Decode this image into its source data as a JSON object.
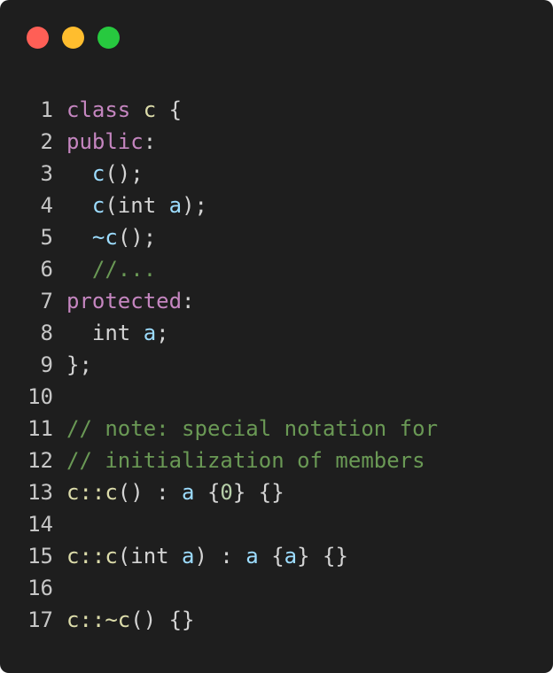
{
  "window": {
    "controls": {
      "close_color": "#ff5f56",
      "minimize_color": "#ffbd2e",
      "maximize_color": "#27c93f"
    }
  },
  "colors": {
    "keyword": "#c586c0",
    "type": "#dcdcaa",
    "identifier": "#9cdcfe",
    "comment": "#6a9955",
    "plain": "#d4d4d4",
    "number": "#b5cea8"
  },
  "lines": [
    {
      "num": "1",
      "tokens": [
        {
          "t": "class",
          "k": "keyword"
        },
        {
          "t": " ",
          "k": "plain"
        },
        {
          "t": "c",
          "k": "type"
        },
        {
          "t": " {",
          "k": "plain"
        }
      ]
    },
    {
      "num": "2",
      "tokens": [
        {
          "t": "public",
          "k": "keyword"
        },
        {
          "t": ":",
          "k": "plain"
        }
      ]
    },
    {
      "num": "3",
      "tokens": [
        {
          "t": "  ",
          "k": "plain"
        },
        {
          "t": "c",
          "k": "identifier"
        },
        {
          "t": "();",
          "k": "plain"
        }
      ]
    },
    {
      "num": "4",
      "tokens": [
        {
          "t": "  ",
          "k": "plain"
        },
        {
          "t": "c",
          "k": "identifier"
        },
        {
          "t": "(int ",
          "k": "plain"
        },
        {
          "t": "a",
          "k": "identifier"
        },
        {
          "t": ");",
          "k": "plain"
        }
      ]
    },
    {
      "num": "5",
      "tokens": [
        {
          "t": "  ",
          "k": "plain"
        },
        {
          "t": "~c",
          "k": "identifier"
        },
        {
          "t": "();",
          "k": "plain"
        }
      ]
    },
    {
      "num": "6",
      "tokens": [
        {
          "t": "  ",
          "k": "plain"
        },
        {
          "t": "//...",
          "k": "comment"
        }
      ]
    },
    {
      "num": "7",
      "tokens": [
        {
          "t": "protected",
          "k": "keyword"
        },
        {
          "t": ":",
          "k": "plain"
        }
      ]
    },
    {
      "num": "8",
      "tokens": [
        {
          "t": "  int ",
          "k": "plain"
        },
        {
          "t": "a",
          "k": "identifier"
        },
        {
          "t": ";",
          "k": "plain"
        }
      ]
    },
    {
      "num": "9",
      "tokens": [
        {
          "t": "};",
          "k": "plain"
        }
      ]
    },
    {
      "num": "10",
      "tokens": []
    },
    {
      "num": "11",
      "tokens": [
        {
          "t": "// note: special notation for",
          "k": "comment"
        }
      ]
    },
    {
      "num": "12",
      "tokens": [
        {
          "t": "// initialization of members",
          "k": "comment"
        }
      ]
    },
    {
      "num": "13",
      "tokens": [
        {
          "t": "c::c",
          "k": "type"
        },
        {
          "t": "() : ",
          "k": "plain"
        },
        {
          "t": "a",
          "k": "identifier"
        },
        {
          "t": " {",
          "k": "plain"
        },
        {
          "t": "0",
          "k": "number"
        },
        {
          "t": "} {}",
          "k": "plain"
        }
      ]
    },
    {
      "num": "14",
      "tokens": []
    },
    {
      "num": "15",
      "tokens": [
        {
          "t": "c::c",
          "k": "type"
        },
        {
          "t": "(int ",
          "k": "plain"
        },
        {
          "t": "a",
          "k": "identifier"
        },
        {
          "t": ") : ",
          "k": "plain"
        },
        {
          "t": "a",
          "k": "identifier"
        },
        {
          "t": " {",
          "k": "plain"
        },
        {
          "t": "a",
          "k": "identifier"
        },
        {
          "t": "} {}",
          "k": "plain"
        }
      ]
    },
    {
      "num": "16",
      "tokens": []
    },
    {
      "num": "17",
      "tokens": [
        {
          "t": "c::~c",
          "k": "type"
        },
        {
          "t": "() {}",
          "k": "plain"
        }
      ]
    }
  ]
}
